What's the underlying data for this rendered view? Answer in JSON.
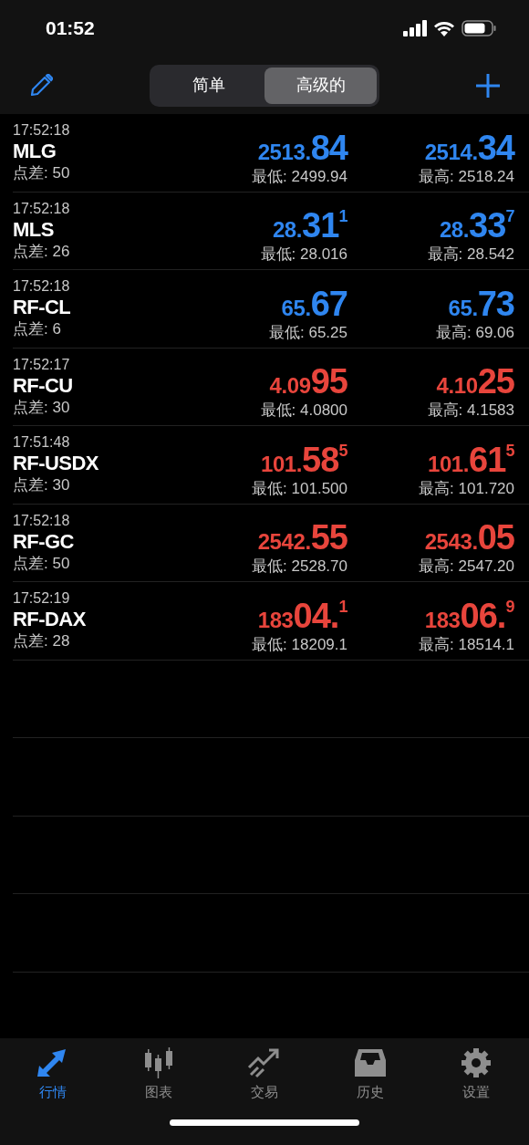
{
  "status_bar": {
    "time": "01:52"
  },
  "segments": [
    {
      "label": "简单",
      "selected": false
    },
    {
      "label": "高级的",
      "selected": true
    }
  ],
  "quotes": [
    {
      "time": "17:52:18",
      "symbol": "MLG",
      "spread": "点差: 50",
      "color": "#2f86f0",
      "bid": {
        "small": "2513.",
        "big": "84"
      },
      "low": "最低: 2499.94",
      "ask": {
        "small": "2514.",
        "big": "34"
      },
      "high": "最高: 2518.24"
    },
    {
      "time": "17:52:18",
      "symbol": "MLS",
      "spread": "点差: 26",
      "color": "#2f86f0",
      "bid": {
        "small": "28.",
        "big": "31",
        "sup": "1"
      },
      "low": "最低: 28.016",
      "ask": {
        "small": "28.",
        "big": "33",
        "sup": "7"
      },
      "high": "最高: 28.542"
    },
    {
      "time": "17:52:18",
      "symbol": "RF-CL",
      "spread": "点差: 6",
      "color": "#2f86f0",
      "bid": {
        "small": "65.",
        "big": "67"
      },
      "low": "最低: 65.25",
      "ask": {
        "small": "65.",
        "big": "73"
      },
      "high": "最高: 69.06"
    },
    {
      "time": "17:52:17",
      "symbol": "RF-CU",
      "spread": "点差: 30",
      "color": "#e8453c",
      "bid": {
        "small": "4.09",
        "big": "95"
      },
      "low": "最低: 4.0800",
      "ask": {
        "small": "4.10",
        "big": "25"
      },
      "high": "最高: 4.1583"
    },
    {
      "time": "17:51:48",
      "symbol": "RF-USDX",
      "spread": "点差: 30",
      "color": "#e8453c",
      "bid": {
        "small": "101.",
        "big": "58",
        "sup": "5"
      },
      "low": "最低: 101.500",
      "ask": {
        "small": "101.",
        "big": "61",
        "sup": "5"
      },
      "high": "最高: 101.720"
    },
    {
      "time": "17:52:18",
      "symbol": "RF-GC",
      "spread": "点差: 50",
      "color": "#e8453c",
      "bid": {
        "small": "2542.",
        "big": "55"
      },
      "low": "最低: 2528.70",
      "ask": {
        "small": "2543.",
        "big": "05"
      },
      "high": "最高: 2547.20"
    },
    {
      "time": "17:52:19",
      "symbol": "RF-DAX",
      "spread": "点差: 28",
      "color": "#e8453c",
      "bid": {
        "small": "183",
        "big": "04.",
        "sup": "1"
      },
      "low": "最低: 18209.1",
      "ask": {
        "small": "183",
        "big": "06.",
        "sup": "9"
      },
      "high": "最高: 18514.1"
    }
  ],
  "tab_bar": [
    {
      "label": "行情",
      "kind": "quotes",
      "selected": true
    },
    {
      "label": "图表",
      "kind": "chart",
      "selected": false
    },
    {
      "label": "交易",
      "kind": "trade",
      "selected": false
    },
    {
      "label": "历史",
      "kind": "history",
      "selected": false
    },
    {
      "label": "设置",
      "kind": "settings",
      "selected": false
    }
  ]
}
